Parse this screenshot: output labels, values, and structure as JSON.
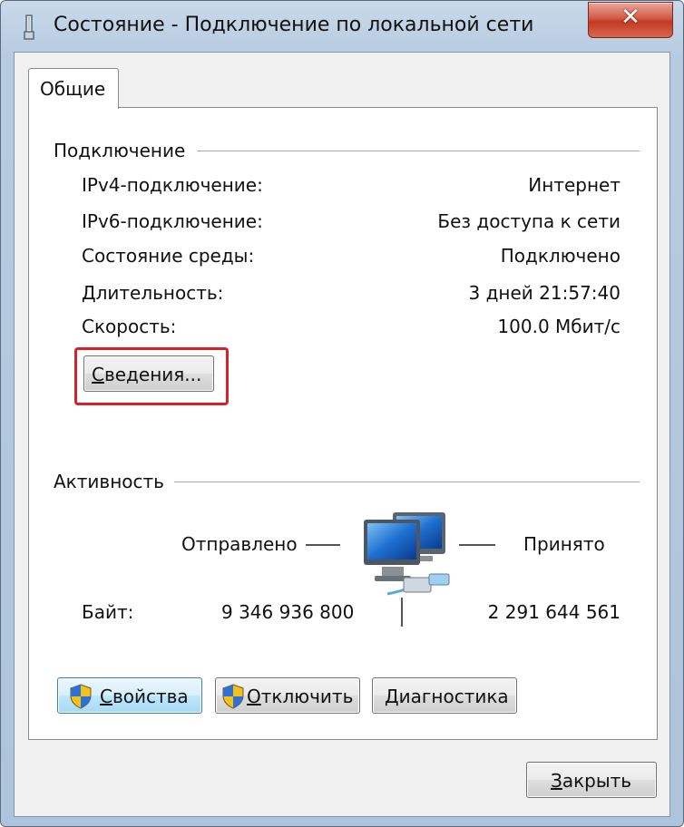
{
  "window": {
    "title": "Состояние - Подключение по локальной сети",
    "close_label": "✕"
  },
  "tabs": [
    {
      "label": "Общие",
      "selected": true
    }
  ],
  "connection": {
    "heading": "Подключение",
    "rows": [
      {
        "label": "IPv4-подключение:",
        "value": "Интернет"
      },
      {
        "label": "IPv6-подключение:",
        "value": "Без доступа к сети"
      },
      {
        "label": "Состояние среды:",
        "value": "Подключено"
      },
      {
        "label": "Длительность:",
        "value": "3 дней 21:57:40"
      },
      {
        "label": "Скорость:",
        "value": "100.0 Мбит/с"
      }
    ],
    "details_button": {
      "mnemonic": "С",
      "rest": "ведения..."
    }
  },
  "activity": {
    "heading": "Активность",
    "sent_label": "Отправлено",
    "received_label": "Принято",
    "bytes_label": "Байт:",
    "bytes_sent": "9 346 936 800",
    "bytes_received": "2 291 644 561",
    "icon": "network-computers-icon"
  },
  "actions": {
    "properties": {
      "mnemonic": "С",
      "rest": "войства",
      "icon": "uac-shield-icon"
    },
    "disable": {
      "mnemonic": "О",
      "rest": "тключить",
      "icon": "uac-shield-icon"
    },
    "diagnose": {
      "mnemonic": "Д",
      "rest": "иагностика"
    }
  },
  "footer": {
    "close": {
      "mnemonic": "З",
      "rest": "акрыть"
    }
  },
  "colors": {
    "highlight_box": "#d3222a",
    "frame": "#b7cbe0",
    "close_button": "#c23a22"
  }
}
